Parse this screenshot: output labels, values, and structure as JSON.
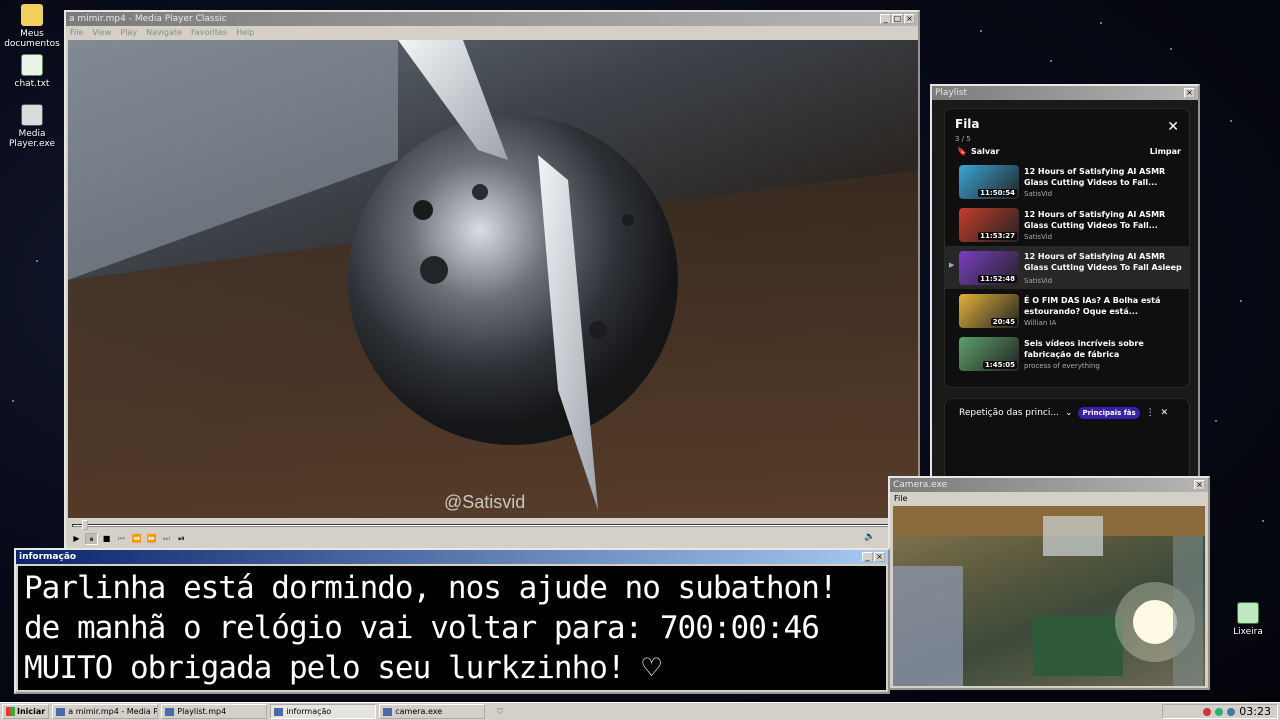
{
  "desktop": {
    "icons": [
      {
        "label": "Meus documentos"
      },
      {
        "label": "chat.txt"
      },
      {
        "label": "Media Player.exe"
      },
      {
        "label": "Lixeira"
      }
    ]
  },
  "mpc": {
    "title": "a mimir.mp4 - Media Player Classic",
    "menu": [
      "File",
      "View",
      "Play",
      "Navigate",
      "Favorites",
      "Help"
    ],
    "watermark": "@Satisvid",
    "seek_progress": 0.01,
    "controls": [
      "▶",
      "⏸",
      "■",
      "⏮",
      "⏪",
      "⏩",
      "⏭",
      "⏯"
    ],
    "volume_icon": "speaker-icon"
  },
  "playlist": {
    "title": "Playlist",
    "queue_title": "Fila",
    "queue_count": "3 / 5",
    "save_label": "Salvar",
    "clear_label": "Limpar",
    "videos": [
      {
        "title": "12 Hours of Satisfying AI ASMR Glass Cutting Videos to Fall...",
        "channel": "SatisVid",
        "duration": "11:50:54",
        "color": "#3aa6d8"
      },
      {
        "title": "12 Hours of Satisfying AI ASMR Glass Cutting Videos To Fall...",
        "channel": "SatisVid",
        "duration": "11:53:27",
        "color": "#c23d2c"
      },
      {
        "title": "12 Hours of Satisfying AI ASMR Glass Cutting Videos To Fall Asleep To",
        "channel": "SatisVid",
        "duration": "11:52:48",
        "color": "#7a3fc2",
        "current": true
      },
      {
        "title": "É O FIM DAS IAs? A Bolha está estourando? Oque está...",
        "channel": "Willian IA",
        "duration": "20:45",
        "color": "#e2b23a"
      },
      {
        "title": "Seis vídeos incríveis sobre fabricação de fábrica",
        "channel": "process of everything",
        "duration": "1:45:05",
        "color": "#5ea06a"
      }
    ],
    "repeat_label": "Repetição das princi...",
    "chips": [
      "Principais fãs"
    ]
  },
  "camera": {
    "title": "Camera.exe",
    "menu": [
      "File"
    ]
  },
  "info": {
    "title": "informação",
    "lines": [
      "Parlinha está dormindo, nos ajude no subathon!",
      "de manhã o relógio vai voltar para:  700:00:46",
      "MUITO obrigada pelo seu lurkzinho! ♡"
    ]
  },
  "taskbar": {
    "start_label": "Iniciar",
    "tasks": [
      {
        "label": "a mimir.mp4 - Media Playe..."
      },
      {
        "label": "Playlist.mp4"
      },
      {
        "label": "informação",
        "active": true
      },
      {
        "label": "camera.exe"
      }
    ],
    "clock": "03:23"
  }
}
